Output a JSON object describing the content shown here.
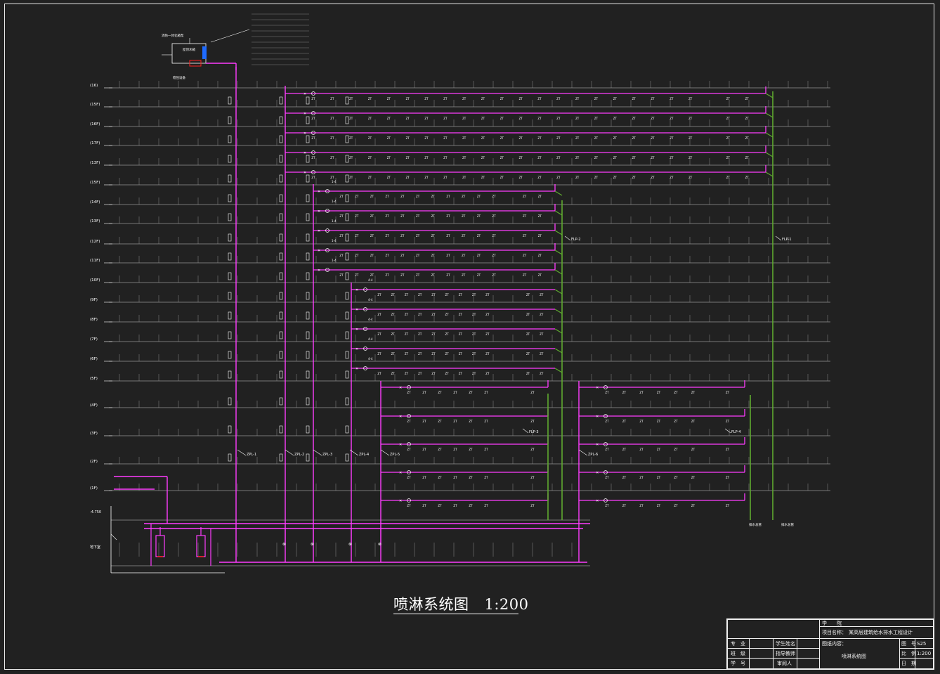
{
  "drawing": {
    "title": "喷淋系统图",
    "scale": "1:200",
    "floors": [
      "(16)",
      "(15F)",
      "(16F)",
      "(17F)",
      "(13F)",
      "(15F)",
      "(14F)",
      "(13F)",
      "(12F)",
      "(11F)",
      "(10F)",
      "(9F)",
      "(8F)",
      "(7F)",
      "(6F)",
      "(5F)",
      "(4F)",
      "(3F)",
      "(2F)",
      "(1F)"
    ],
    "riser_labels": [
      "ZPL-1",
      "ZPL-2",
      "ZPL-3",
      "ZPL-4",
      "ZPL-5",
      "ZPL-6"
    ],
    "fire_risers": [
      "FLP-1",
      "FLP-2",
      "FLP-3",
      "FLP-4"
    ],
    "drain_notes": [
      "排水总管",
      "排水总管"
    ],
    "roof_notes": [
      "消防一体化箱泵",
      "屋顶水箱",
      "稳压设备"
    ],
    "colors": {
      "pipe": "#ff3cff",
      "drain": "#5faa2f",
      "grid": "#d0d0d0",
      "annotation": "#ffffff",
      "equipment": "#1e6bff",
      "alarm": "#ff2020"
    }
  },
  "title_block": {
    "school_label": "学　　院",
    "project_label": "项目名称：",
    "project_value": "某高层建筑给水排水工程设计",
    "major_label": "专　业",
    "class_label": "班　级",
    "id_label": "学　号",
    "student_label": "学生姓名",
    "advisor_label": "指导教师",
    "reviewer_label": "审阅人",
    "content_label": "图纸内容：",
    "content_value": "喷淋系统图",
    "sheet_label": "图　号",
    "sheet_value": "S25",
    "scale_label": "比　例",
    "scale_value": "1:200",
    "date_label": "日　期"
  }
}
